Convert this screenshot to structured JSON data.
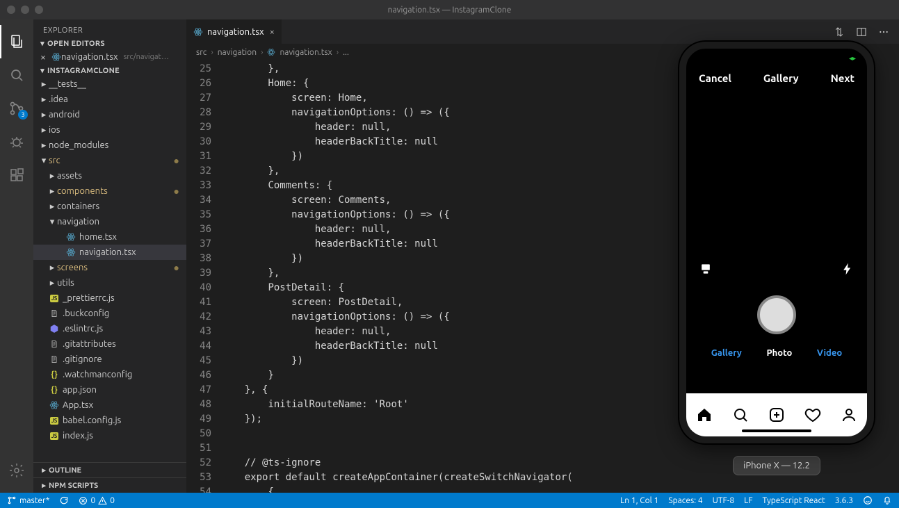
{
  "window": {
    "title": "navigation.tsx — InstagramClone"
  },
  "explorer": {
    "title": "EXPLORER",
    "openEditors": {
      "label": "OPEN EDITORS",
      "items": [
        {
          "name": "navigation.tsx",
          "path": "src/navigat…"
        }
      ]
    },
    "workspace": {
      "label": "INSTAGRAMCLONE"
    },
    "tree": [
      {
        "depth": 1,
        "type": "folder",
        "open": false,
        "name": "__tests__"
      },
      {
        "depth": 1,
        "type": "folder",
        "open": false,
        "name": ".idea"
      },
      {
        "depth": 1,
        "type": "folder",
        "open": false,
        "name": "android"
      },
      {
        "depth": 1,
        "type": "folder",
        "open": false,
        "name": "ios"
      },
      {
        "depth": 1,
        "type": "folder",
        "open": false,
        "name": "node_modules"
      },
      {
        "depth": 1,
        "type": "folder",
        "open": true,
        "name": "src",
        "mod": true,
        "dot": true
      },
      {
        "depth": 2,
        "type": "folder",
        "open": false,
        "name": "assets"
      },
      {
        "depth": 2,
        "type": "folder",
        "open": false,
        "name": "components",
        "mod": true,
        "dot": true
      },
      {
        "depth": 2,
        "type": "folder",
        "open": false,
        "name": "containers"
      },
      {
        "depth": 2,
        "type": "folder",
        "open": true,
        "name": "navigation"
      },
      {
        "depth": 3,
        "type": "file",
        "icon": "react",
        "name": "home.tsx"
      },
      {
        "depth": 3,
        "type": "file",
        "icon": "react",
        "name": "navigation.tsx",
        "sel": true
      },
      {
        "depth": 2,
        "type": "folder",
        "open": false,
        "name": "screens",
        "mod": true,
        "dot": true
      },
      {
        "depth": 2,
        "type": "folder",
        "open": false,
        "name": "utils"
      },
      {
        "depth": 1,
        "type": "file",
        "icon": "js",
        "name": "_prettierrc.js"
      },
      {
        "depth": 1,
        "type": "file",
        "icon": "txt",
        "name": ".buckconfig"
      },
      {
        "depth": 1,
        "type": "file",
        "icon": "eslint",
        "name": ".eslintrc.js"
      },
      {
        "depth": 1,
        "type": "file",
        "icon": "txt",
        "name": ".gitattributes"
      },
      {
        "depth": 1,
        "type": "file",
        "icon": "txt",
        "name": ".gitignore"
      },
      {
        "depth": 1,
        "type": "file",
        "icon": "json",
        "name": ".watchmanconfig"
      },
      {
        "depth": 1,
        "type": "file",
        "icon": "json",
        "name": "app.json"
      },
      {
        "depth": 1,
        "type": "file",
        "icon": "react",
        "name": "App.tsx"
      },
      {
        "depth": 1,
        "type": "file",
        "icon": "js",
        "name": "babel.config.js"
      },
      {
        "depth": 1,
        "type": "file",
        "icon": "js",
        "name": "index.js"
      }
    ],
    "outline": "OUTLINE",
    "npmscripts": "NPM SCRIPTS"
  },
  "scm_badge": "3",
  "editor": {
    "tab": {
      "name": "navigation.tsx"
    },
    "breadcrumbs": [
      "src",
      "navigation",
      "navigation.tsx",
      "..."
    ],
    "startLine": 25,
    "code": [
      "        },",
      "        <prop>Home</prop><pun>:</pun> <pun>{</pun>",
      "            <prop>screen</prop><pun>:</pun> <cls>Home</cls><pun>,</pun>",
      "            <fn>navigationOptions</fn><pun>:</pun> <pun>()</pun> <kw>=></kw> <pun>({</pun>",
      "                <prop>header</prop><pun>:</pun> <kw>null</kw><pun>,</pun>",
      "                <prop>headerBackTitle</prop><pun>:</pun> <kw>null</kw>",
      "            <pun>})</pun>",
      "        <pun>},</pun>",
      "        <prop>Comments</prop><pun>:</pun> <pun>{</pun>",
      "            <prop>screen</prop><pun>:</pun> <cls>Comments</cls><pun>,</pun>",
      "            <fn>navigationOptions</fn><pun>:</pun> <pun>()</pun> <kw>=></kw> <pun>({</pun>",
      "                <prop>header</prop><pun>:</pun> <kw>null</kw><pun>,</pun>",
      "                <prop>headerBackTitle</prop><pun>:</pun> <kw>null</kw>",
      "            <pun>})</pun>",
      "        <pun>},</pun>",
      "        <prop>PostDetail</prop><pun>:</pun> <pun>{</pun>",
      "            <prop>screen</prop><pun>:</pun> <cls>PostDetail</cls><pun>,</pun>",
      "            <fn>navigationOptions</fn><pun>:</pun> <pun>()</pun> <kw>=></kw> <pun>({</pun>",
      "                <prop>header</prop><pun>:</pun> <kw>null</kw><pun>,</pun>",
      "                <prop>headerBackTitle</prop><pun>:</pun> <kw>null</kw>",
      "            <pun>})</pun>",
      "        <pun>}</pun>",
      "    <pun>}, {</pun>",
      "        <prop>initialRouteName</prop><pun>:</pun> <str>'Root'</str>",
      "    <pun>});</pun>",
      "",
      "",
      "    <cmt>// @ts-ignore</cmt>",
      "    <kw2>export</kw2> <kw2>default</kw2> <fn>createAppContainer</fn><pun>(</pun><fn>createSwitchNavigator</fn><pun>(</pun>",
      "        <pun>{</pun>"
    ]
  },
  "simulator": {
    "header": {
      "left": "Cancel",
      "center": "Gallery",
      "right": "Next"
    },
    "modes": [
      "Gallery",
      "Photo",
      "Video"
    ],
    "label": "iPhone X — 12.2"
  },
  "statusbar": {
    "branch": "master*",
    "errors": "0",
    "warnings": "0",
    "lncol": "Ln 1, Col 1",
    "spaces": "Spaces: 4",
    "encoding": "UTF-8",
    "eol": "LF",
    "lang": "TypeScript React",
    "tsver": "3.6.3"
  }
}
